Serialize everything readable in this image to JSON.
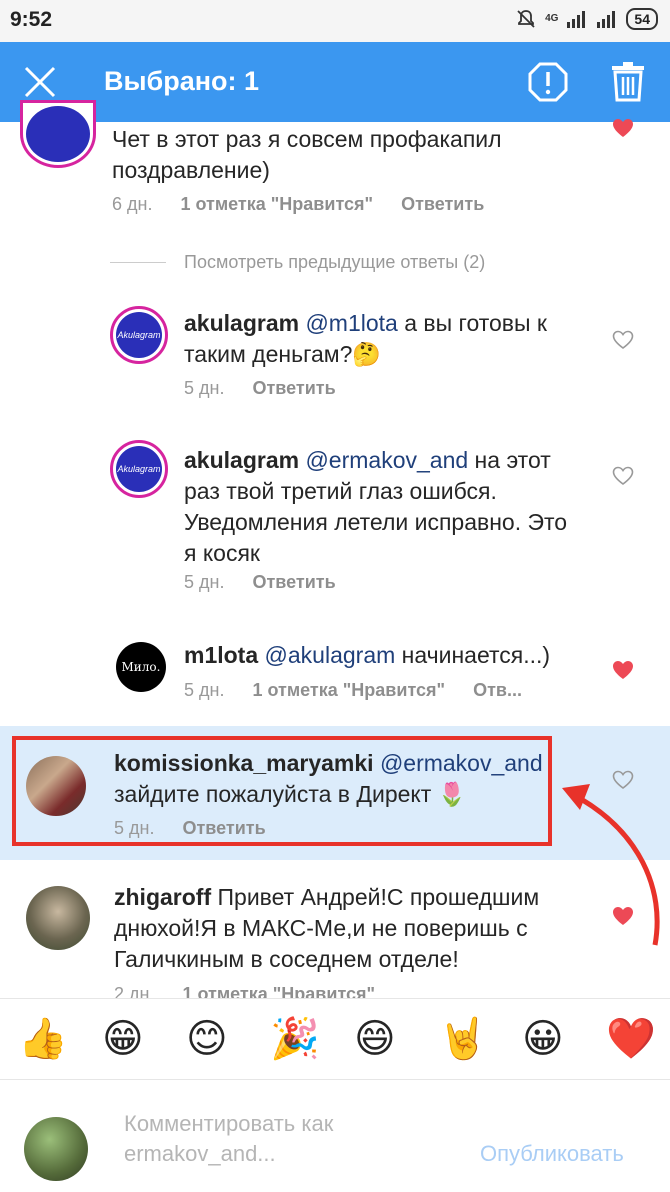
{
  "status_bar": {
    "time": "9:52",
    "network": "4G",
    "battery": "54"
  },
  "action_bar": {
    "title": "Выбрано: 1"
  },
  "comments": [
    {
      "text": "Чет в этот раз я совсем профакапил поздравление)",
      "time": "6 дн.",
      "likes": "1 отметка \"Нравится\"",
      "reply": "Ответить",
      "liked": true
    }
  ],
  "view_previous": "Посмотреть предыдущие ответы (2)",
  "replies": [
    {
      "username": "akulagram",
      "mention": "@m1lota",
      "text": " а вы готовы к таким деньгам?🤔",
      "time": "5 дн.",
      "reply": "Ответить",
      "avatar_text": "Akulagram"
    },
    {
      "username": "akulagram",
      "mention": "@ermakov_and",
      "text": " на этот раз твой третий глаз ошибся. Уведомления летели исправно. Это я косяк",
      "time": "5 дн.",
      "reply": "Ответить",
      "avatar_text": "Akulagram"
    },
    {
      "username": "m1lota",
      "mention": "@akulagram",
      "text": " начинается...)",
      "time": "5 дн.",
      "likes": "1 отметка \"Нравится\"",
      "reply": "Отв...",
      "avatar_text": "Мило."
    },
    {
      "username": "komissionka_maryamki",
      "mention": "@ermakov_and",
      "text": "зайдите пожалуйста в Директ 🌷",
      "time": "5 дн.",
      "reply": "Ответить"
    }
  ],
  "last_comment": {
    "username": "zhigaroff",
    "text": " Привет Андрей!С прошедшим днюхой!Я в МАКС-Ме,и не поверишь с Галичкиным в соседнем отделе!",
    "time": "2 дн.",
    "likes": "1 отметка \"Нравится\""
  },
  "emoji_bar": [
    "👍",
    "😁",
    "😊",
    "🎉",
    "😄",
    "🤘",
    "😀",
    "❤️"
  ],
  "composer": {
    "placeholder_line1": "Комментировать как",
    "placeholder_line2": "ermakov_and...",
    "publish": "Опубликовать"
  },
  "colors": {
    "accent": "#3b97f0",
    "highlight": "#e8322a",
    "selected": "#dcecfb",
    "like": "#ed4956"
  }
}
